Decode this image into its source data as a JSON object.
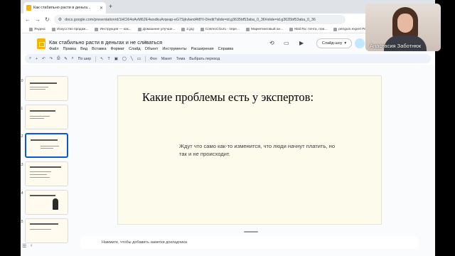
{
  "browser": {
    "tab_title": "Как стабильно расти в деньга...",
    "url": "docs.google.com/presentation/d/1HCl64oAvM62E4wxdkuArqeap-eG7Sjkvland4t8Yi-0/edit?slide=id.g3635bf53aba_0_36#slide=id.g3635bf53aba_0_36",
    "bookmarks": [
      "Яндекс",
      "Искусство продаж...",
      "Инструкция — как...",
      "Домашние улучше...",
      "2.jpg",
      "CosmoCGuru - пере...",
      "Маркетинговый ан...",
      "Mail.Ru: почта, пои...",
      "penguin.expert Реа..."
    ]
  },
  "doc": {
    "title": "Как стабильно расти в деньгах и не сливаться",
    "menu": [
      "Файл",
      "Правка",
      "Вид",
      "Вставка",
      "Формат",
      "Слайд",
      "Объект",
      "Инструменты",
      "Расширения",
      "Справка"
    ],
    "slideshow_label": "Слайд-шоу"
  },
  "toolbar": {
    "zoom": "По шир",
    "items": [
      "Фон",
      "Макет",
      "Тема",
      "Выбрать переход"
    ]
  },
  "filmstrip": {
    "slides": [
      {
        "num": "10"
      },
      {
        "num": "11"
      },
      {
        "num": "12",
        "selected": true
      },
      {
        "num": "13"
      },
      {
        "num": "14"
      },
      {
        "num": "15"
      }
    ]
  },
  "slide": {
    "title": "Какие проблемы есть у экспертов:",
    "body": "Ждут что само как-то изменится, что люди начнут платить, но так и не происходит."
  },
  "notes": {
    "placeholder": "Нажмите, чтобы добавить заметки докладчика"
  },
  "webcam": {
    "name": "Анастасия Заботнюк"
  },
  "colors": {
    "accent": "#0b57d0",
    "slide_bg": "#fdfbec",
    "docs_logo": "#f4b400"
  }
}
